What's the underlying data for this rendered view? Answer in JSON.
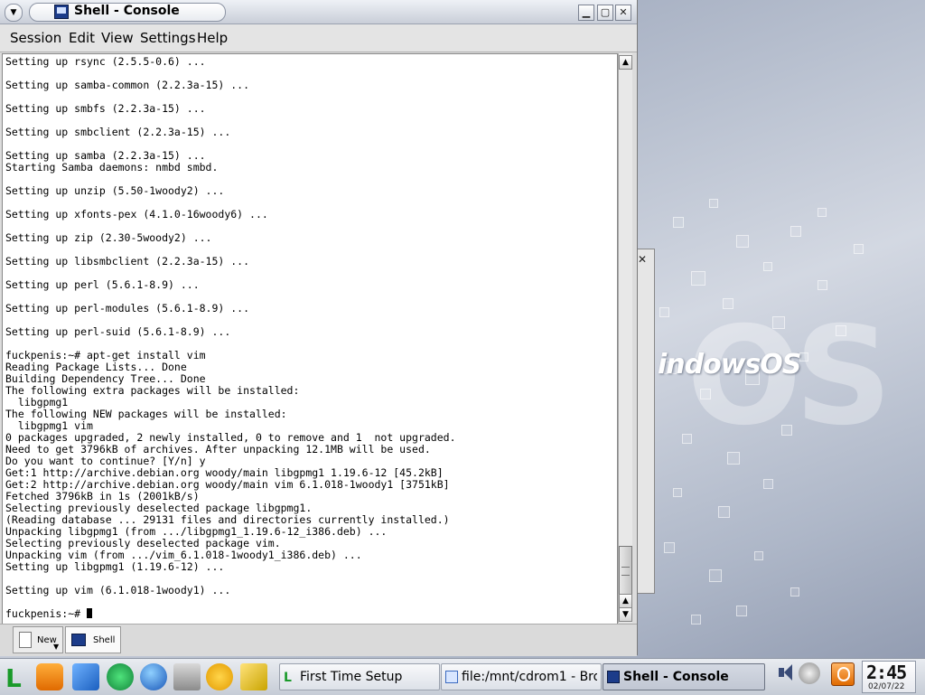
{
  "window": {
    "title": "Shell - Console",
    "menu": [
      "Session",
      "Edit",
      "View",
      "Settings",
      "Help"
    ]
  },
  "terminal": {
    "lines": [
      "Setting up rsync (2.5.5-0.6) ...",
      "",
      "Setting up samba-common (2.2.3a-15) ...",
      "",
      "Setting up smbfs (2.2.3a-15) ...",
      "",
      "Setting up smbclient (2.2.3a-15) ...",
      "",
      "Setting up samba (2.2.3a-15) ...",
      "Starting Samba daemons: nmbd smbd.",
      "",
      "Setting up unzip (5.50-1woody2) ...",
      "",
      "Setting up xfonts-pex (4.1.0-16woody6) ...",
      "",
      "Setting up zip (2.30-5woody2) ...",
      "",
      "Setting up libsmbclient (2.2.3a-15) ...",
      "",
      "Setting up perl (5.6.1-8.9) ...",
      "",
      "Setting up perl-modules (5.6.1-8.9) ...",
      "",
      "Setting up perl-suid (5.6.1-8.9) ...",
      "",
      "fuckpenis:~# apt-get install vim",
      "Reading Package Lists... Done",
      "Building Dependency Tree... Done",
      "The following extra packages will be installed:",
      "  libgpmg1",
      "The following NEW packages will be installed:",
      "  libgpmg1 vim",
      "0 packages upgraded, 2 newly installed, 0 to remove and 1  not upgraded.",
      "Need to get 3796kB of archives. After unpacking 12.1MB will be used.",
      "Do you want to continue? [Y/n] y",
      "Get:1 http://archive.debian.org woody/main libgpmg1 1.19.6-12 [45.2kB]",
      "Get:2 http://archive.debian.org woody/main vim 6.1.018-1woody1 [3751kB]",
      "Fetched 3796kB in 1s (2001kB/s)",
      "Selecting previously deselected package libgpmg1.",
      "(Reading database ... 29131 files and directories currently installed.)",
      "Unpacking libgpmg1 (from .../libgpmg1_1.19.6-12_i386.deb) ...",
      "Selecting previously deselected package vim.",
      "Unpacking vim (from .../vim_6.1.018-1woody1_i386.deb) ...",
      "Setting up libgpmg1 (1.19.6-12) ...",
      "",
      "Setting up vim (6.1.018-1woody1) ...",
      ""
    ],
    "prompt": "fuckpenis:~# "
  },
  "tabs": {
    "new": "New",
    "shell": "Shell"
  },
  "desktop": {
    "logo_text": "indowsOS",
    "logo_big": "OS"
  },
  "taskbar": {
    "tasks": [
      "First Time Setup",
      "file:/mnt/cdrom1 - Brow",
      "Shell - Console"
    ],
    "clock_time": "2:45",
    "clock_date": "02/07/22"
  },
  "colors": {
    "accent": "#1c3c8a",
    "terminal_bg": "#ffffff",
    "terminal_fg": "#000000"
  }
}
